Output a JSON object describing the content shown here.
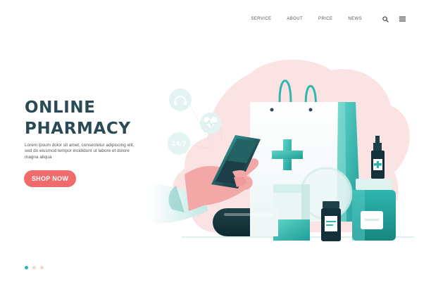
{
  "nav": {
    "links": [
      {
        "label": "SERVICE"
      },
      {
        "label": "ABOUT"
      },
      {
        "label": "PRICE"
      },
      {
        "label": "NEWS"
      }
    ],
    "search_icon": "search-icon",
    "menu_icon": "hamburger-menu-icon"
  },
  "hero": {
    "title_line1": "ONLINE",
    "title_line2": "PHARMACY",
    "description": "Lorem ipsum dolor sit amet, consectetur adipiscing elit, sed do eiusmod tempor incididunt ut labore et dolore magna aliqua",
    "cta_label": "SHOP NOW"
  },
  "illustration": {
    "badge_247": "24/7",
    "icons": [
      "headset-icon",
      "heart-pulse-icon",
      "24-7-icon"
    ]
  },
  "pagination": {
    "total": 3,
    "active": 1
  },
  "colors": {
    "accent": "#2fb6b0",
    "brand_dark": "#2a4a55",
    "cta": "#f06c6c",
    "blob": "#fbe3e3"
  }
}
